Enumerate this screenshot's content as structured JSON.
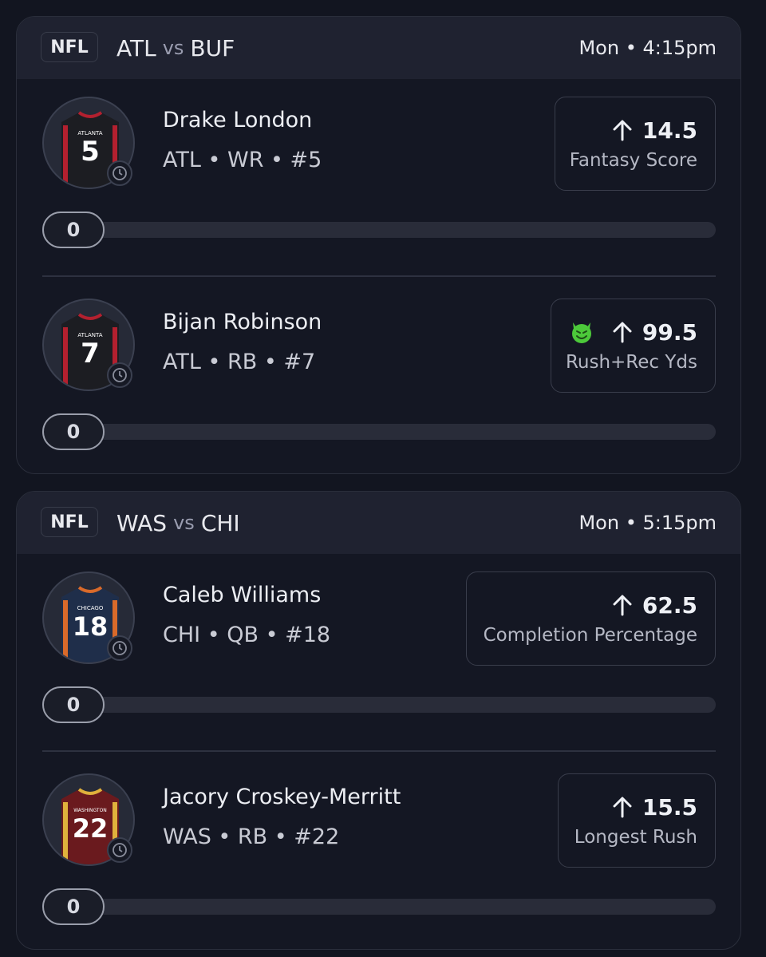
{
  "games": [
    {
      "league": "NFL",
      "away": "ATL",
      "vs": "vs",
      "home": "BUF",
      "time": "Mon • 4:15pm",
      "players": [
        {
          "name": "Drake London",
          "meta": "ATL • WR • #5",
          "jersey": {
            "city": "ATLANTA",
            "number": "5",
            "color": "#1c1d22",
            "accent": "#b3202f"
          },
          "stat_value": "14.5",
          "stat_label": "Fantasy Score",
          "direction_icon": "arrow-up-icon",
          "badge_icon": "",
          "progress": "0"
        },
        {
          "name": "Bijan Robinson",
          "meta": "ATL • RB • #7",
          "jersey": {
            "city": "ATLANTA",
            "number": "7",
            "color": "#1c1d22",
            "accent": "#b3202f"
          },
          "stat_value": "99.5",
          "stat_label": "Rush+Rec Yds",
          "direction_icon": "arrow-up-icon",
          "badge_icon": "devil-emoji-icon",
          "progress": "0"
        }
      ]
    },
    {
      "league": "NFL",
      "away": "WAS",
      "vs": "vs",
      "home": "CHI",
      "time": "Mon • 5:15pm",
      "players": [
        {
          "name": "Caleb Williams",
          "meta": "CHI • QB • #18",
          "jersey": {
            "city": "CHICAGO",
            "number": "18",
            "color": "#1f2e4a",
            "accent": "#d96a2a"
          },
          "stat_value": "62.5",
          "stat_label": "Completion Percentage",
          "direction_icon": "arrow-up-icon",
          "badge_icon": "",
          "progress": "0"
        },
        {
          "name": "Jacory Croskey-Merritt",
          "meta": "WAS • RB • #22",
          "jersey": {
            "city": "WASHINGTON",
            "number": "22",
            "color": "#6a1a1e",
            "accent": "#e0b13c"
          },
          "stat_value": "15.5",
          "stat_label": "Longest Rush",
          "direction_icon": "arrow-up-icon",
          "badge_icon": "",
          "progress": "0"
        }
      ]
    }
  ],
  "colors": {
    "background": "#121520",
    "card": "#141723",
    "header": "#1f2230",
    "devil_green": "#4cc93a"
  }
}
